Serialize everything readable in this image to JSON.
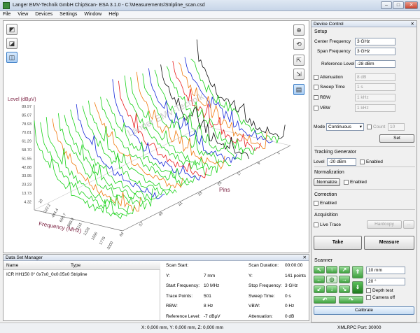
{
  "window": {
    "title": "Langer EMV-Technik GmbH ChipScan- ESA 3.1.0 - C:\\Measurements\\Stripline_scan.csd",
    "minimize": "–",
    "maximize": "□",
    "close": "✕"
  },
  "menu": [
    "File",
    "View",
    "Devices",
    "Settings",
    "Window",
    "Help"
  ],
  "plot": {
    "y_axis_label": "Level (dBµV)",
    "y_ticks": [
      "89.97",
      "85.07",
      "78.93",
      "70.81",
      "61.29",
      "58.70",
      "51.55",
      "42.88",
      "33.95",
      "23.23",
      "13.73",
      "4.32"
    ],
    "x_axis_label": "Frequency (MHz)",
    "x_ticks": [
      "10",
      "222.2",
      "444.4",
      "666.7",
      "888.9",
      "1111",
      "1333",
      "1556",
      "1778",
      "2000"
    ],
    "z_axis_label": "Pins",
    "z_ticks": [
      "64",
      "57",
      "49",
      "41",
      "33",
      "25",
      "17",
      "9",
      "1"
    ],
    "watermark": "Langer EMV-Technik"
  },
  "device_control": {
    "header": "Device Control",
    "setup_label": "Setup",
    "center_frequency_label": "Center Frequency",
    "center_frequency_value": "3 GHz",
    "span_frequency_label": "Span Frequency",
    "span_frequency_value": "3 GHz",
    "reference_level_label": "Reference Level",
    "reference_level_value": "-28 dBm",
    "attenuation_label": "Attenuation",
    "attenuation_value": "8 dB",
    "sweep_time_label": "Sweep Time",
    "sweep_time_value": "1 s",
    "rbw_label": "RBW",
    "rbw_value": "1 kHz",
    "vbw_label": "VBW",
    "vbw_value": "1 kHz",
    "mode_label": "Mode",
    "mode_value": "Continuous",
    "count_label": "Count",
    "count_value": "10",
    "set_button": "Set",
    "tracking_generator_label": "Tracking Generator",
    "tg_level_label": "Level",
    "tg_level_value": "-20 dBm",
    "tg_enabled_label": "Enabled",
    "normalization_label": "Normalization",
    "normalize_button": "Normalize",
    "norm_enabled_label": "Enabled",
    "correction_label": "Correction",
    "corr_enabled_label": "Enabled",
    "acquisition_label": "Acquisition",
    "live_trace_label": "Live Trace",
    "hardcopy_button": "Hardcopy",
    "more_button": "...",
    "take_button": "Take",
    "measure_button": "Measure",
    "scanner_label": "Scanner",
    "step_value": "10 mm",
    "angle_value": "20 °",
    "depth_test_label": "Depth test",
    "camera_off_label": "Camera off",
    "calibrate_button": "Calibrate"
  },
  "data_set_manager": {
    "header": "Data Set Manager",
    "columns": [
      "Name",
      "Type"
    ],
    "rows": [
      {
        "name": "ICR HH150 0° 0x7x0_0x0.05x0",
        "type": "Stripline"
      }
    ],
    "details_left": [
      {
        "label": "Scan Start:",
        "value": ""
      },
      {
        "label": "Y:",
        "value": "7 mm"
      },
      {
        "label": "Start Frequency:",
        "value": "10 MHz"
      },
      {
        "label": "Trace Points:",
        "value": "501"
      },
      {
        "label": "RBW:",
        "value": "8 Hz"
      },
      {
        "label": "Reference Level:",
        "value": "-7 dBµV"
      }
    ],
    "details_right": [
      {
        "label": "Scan Duration:",
        "value": "00:00:00"
      },
      {
        "label": "Y:",
        "value": "141 points"
      },
      {
        "label": "Stop Frequency:",
        "value": "3  GHz"
      },
      {
        "label": "Sweep Time:",
        "value": "0 s"
      },
      {
        "label": "VBW:",
        "value": "0 Hz"
      },
      {
        "label": "Attenuation:",
        "value": "0 dB"
      }
    ]
  },
  "status": {
    "position": "X: 0,000 mm, Y: 0,000 mm, Z: 0,000 mm",
    "xmlrpc": "XMLRPC Port: 30000"
  },
  "colors": {
    "green_trace": "#19d219",
    "orange_trace": "#f07a0f",
    "blue_trace": "#1426d8",
    "red_trace": "#e81b1b",
    "black_trace": "#111111"
  }
}
